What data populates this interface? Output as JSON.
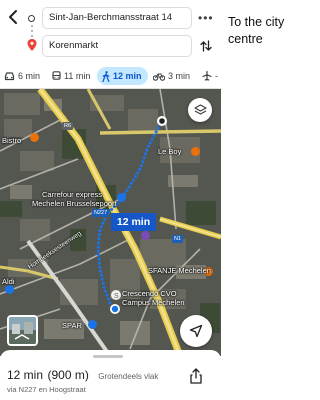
{
  "side_note": "To the city centre",
  "header": {
    "origin": "Sint-Jan-Berchmansstraat 14",
    "destination": "Korenmarkt"
  },
  "modes": [
    {
      "icon": "car-icon",
      "label": "6 min"
    },
    {
      "icon": "bus-icon",
      "label": "11 min"
    },
    {
      "icon": "walk-icon",
      "label": "12 min",
      "active": true
    },
    {
      "icon": "bike-icon",
      "label": "3 min"
    },
    {
      "icon": "plane-icon",
      "label": "-"
    }
  ],
  "map": {
    "route_time_badge": "12 min",
    "labels": {
      "bistro": "Bistro",
      "le_boy": "Le Boy",
      "carrefour": "Carrefour express",
      "carrefour_sub": "Mechelen Brusselsepoort",
      "hombeeksesteenweg": "Hombeeksesteenweg",
      "sfan": "SFANJE Mechelen",
      "crescendo": "Crescendo CVO",
      "crescendo_sub": "Campus Mechelen",
      "spar": "SPAR",
      "aldi": "Aldi"
    },
    "road_shields": {
      "r6": "R6",
      "n227": "N227",
      "n1": "N1"
    },
    "route_color": "#1a73e8"
  },
  "sheet": {
    "time": "12 min",
    "distance": "(900 m)",
    "terrain": "Grotendeels vlak",
    "via": "via N227 en Hoogstraat"
  }
}
